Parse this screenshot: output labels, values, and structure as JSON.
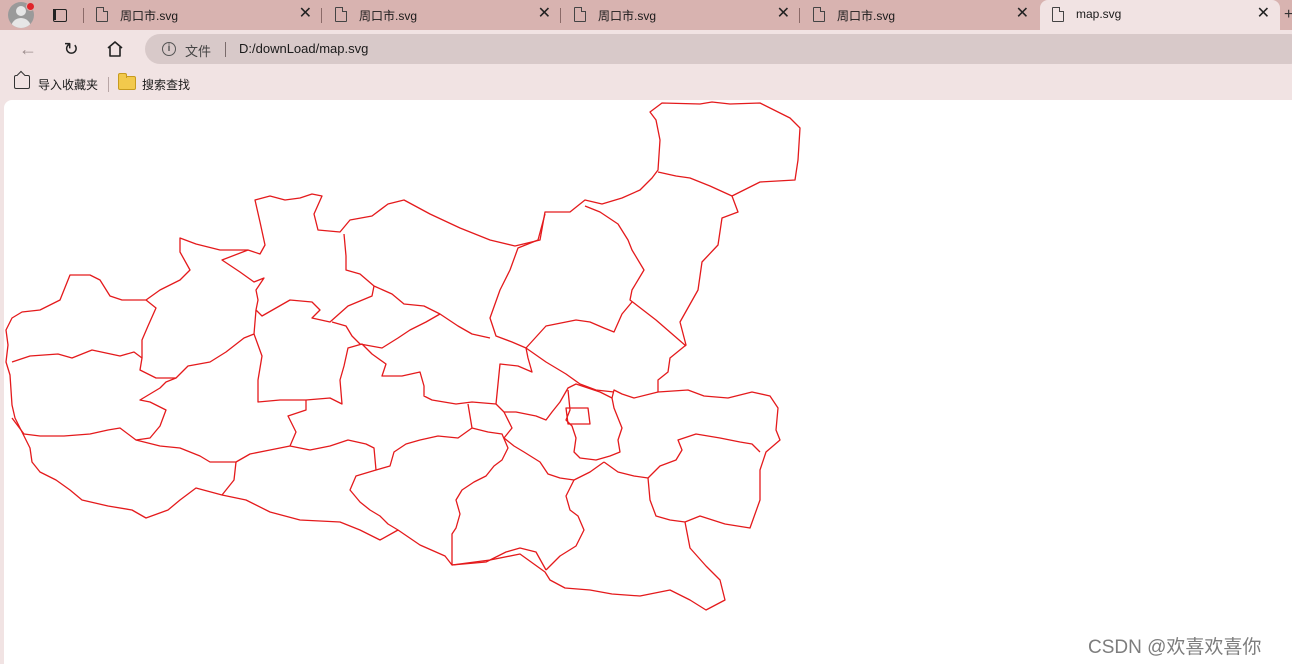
{
  "tabs": [
    {
      "label": "周口市.svg",
      "close": "✕",
      "icon": "file-icon"
    },
    {
      "label": "周口市.svg",
      "close": "✕",
      "icon": "file-icon"
    },
    {
      "label": "周口市.svg",
      "close": "✕",
      "icon": "file-icon"
    },
    {
      "label": "周口市.svg",
      "close": "✕",
      "icon": "file-icon"
    },
    {
      "label": "map.svg",
      "close": "✕",
      "icon": "file-icon",
      "active": true
    }
  ],
  "address": {
    "scheme_label": "文件",
    "url": "D:/downLoad/map.svg"
  },
  "bookmarks": [
    {
      "label": "导入收藏夹",
      "icon": "import-icon"
    },
    {
      "label": "搜索查找",
      "icon": "folder-icon"
    }
  ],
  "map": {
    "stroke_color": "#e41a1c",
    "background": "#ffffff"
  },
  "watermark": "CSDN @欢喜欢喜你",
  "colors": {
    "tab_strip": "#d8b3b0",
    "toolbar": "#f1e3e3",
    "omnibox": "#d8c9c9"
  }
}
